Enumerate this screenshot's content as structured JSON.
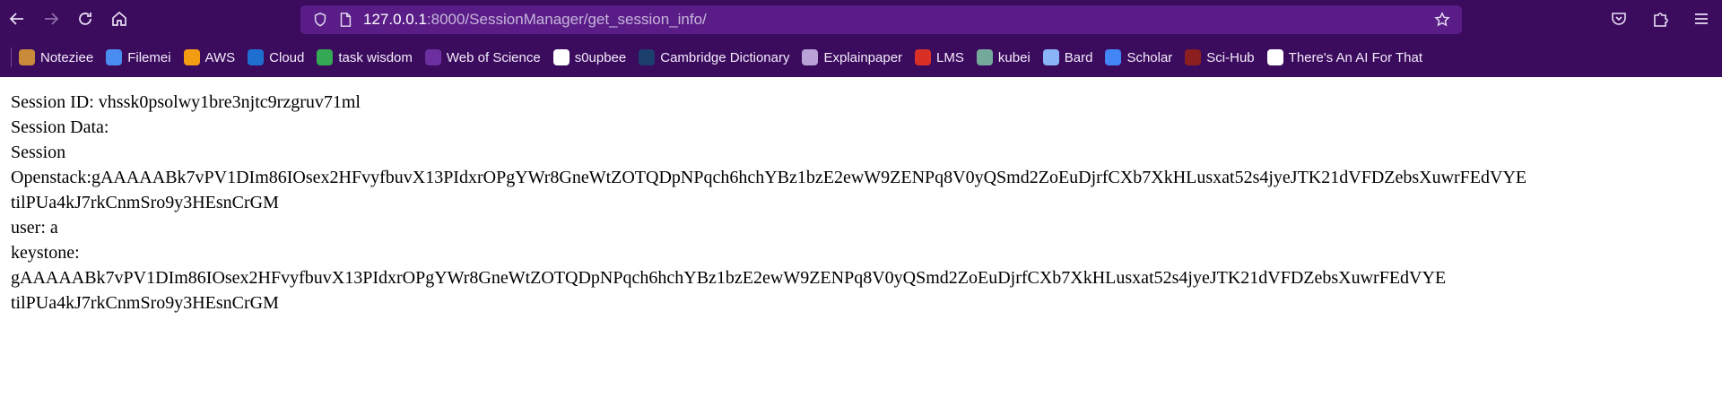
{
  "url": {
    "host": "127.0.0.1",
    "rest": ":8000/SessionManager/get_session_info/"
  },
  "bookmarks": [
    {
      "label": "Noteziee",
      "icon": "notebook-icon",
      "color": "#c98b3a"
    },
    {
      "label": "Filemei",
      "icon": "file-icon",
      "color": "#4a8df0"
    },
    {
      "label": "AWS",
      "icon": "aws-icon",
      "color": "#f39c12"
    },
    {
      "label": "Cloud",
      "icon": "trello-icon",
      "color": "#1f6fd1"
    },
    {
      "label": "task wisdom",
      "icon": "drive-icon",
      "color": "#34a853"
    },
    {
      "label": "Web of Science",
      "icon": "clarivate-icon",
      "color": "#6b2fa0"
    },
    {
      "label": "s0upbee",
      "icon": "github-icon",
      "color": "#ffffff"
    },
    {
      "label": "Cambridge Dictionary",
      "icon": "cambridge-icon",
      "color": "#1d3f6e"
    },
    {
      "label": "Explainpaper",
      "icon": "globe-icon",
      "color": "#b9a3d6"
    },
    {
      "label": "LMS",
      "icon": "lms-icon",
      "color": "#d93025"
    },
    {
      "label": "kubei",
      "icon": "chatgpt-icon",
      "color": "#74aa9c"
    },
    {
      "label": "Bard",
      "icon": "bard-icon",
      "color": "#8ab4f8"
    },
    {
      "label": "Scholar",
      "icon": "scholar-icon",
      "color": "#4285f4"
    },
    {
      "label": "Sci-Hub",
      "icon": "scihub-icon",
      "color": "#8b1f1f"
    },
    {
      "label": "There's An AI For That",
      "icon": "arm-icon",
      "color": "#ffffff"
    }
  ],
  "content": {
    "session_id": "Session ID: vhssk0psolwy1bre3njtc9rzgruv71ml",
    "session_data_label": "Session Data:",
    "session_label": "Session",
    "openstack_line": "Openstack:gAAAAABk7vPV1DIm86IOsex2HFvyfbuvX13PIdxrOPgYWr8GneWtZOTQDpNPqch6hchYBz1bzE2ewW9ZENPq8V0yQSmd2ZoEuDjrfCXb7XkHLusxat52s4jyeJTK21dVFDZebsXuwrFEdVYE",
    "openstack_cont": "tilPUa4kJ7rkCnmSro9y3HEsnCrGM",
    "user_line": "user: a",
    "keystone_label": "keystone:",
    "keystone_line": "gAAAAABk7vPV1DIm86IOsex2HFvyfbuvX13PIdxrOPgYWr8GneWtZOTQDpNPqch6hchYBz1bzE2ewW9ZENPq8V0yQSmd2ZoEuDjrfCXb7XkHLusxat52s4jyeJTK21dVFDZebsXuwrFEdVYE",
    "keystone_cont": "tilPUa4kJ7rkCnmSro9y3HEsnCrGM"
  }
}
